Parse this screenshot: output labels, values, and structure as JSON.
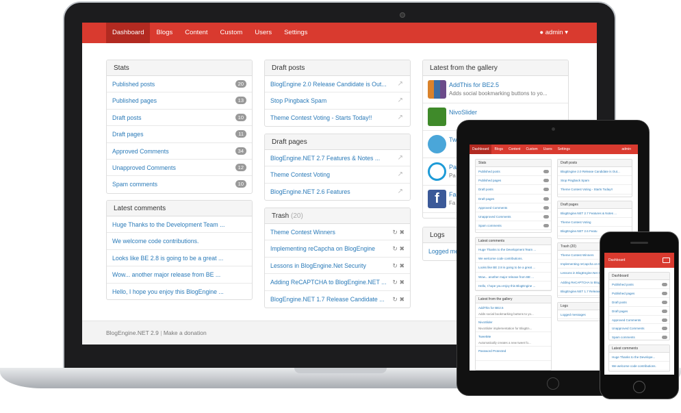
{
  "nav": {
    "items": [
      "Dashboard",
      "Blogs",
      "Content",
      "Custom",
      "Users",
      "Settings"
    ],
    "user": "admin"
  },
  "stats": {
    "title": "Stats",
    "rows": [
      {
        "label": "Published posts",
        "count": "20"
      },
      {
        "label": "Published pages",
        "count": "13"
      },
      {
        "label": "Draft posts",
        "count": "10"
      },
      {
        "label": "Draft pages",
        "count": "11"
      },
      {
        "label": "Approved Comments",
        "count": "34"
      },
      {
        "label": "Unapproved Comments",
        "count": "12"
      },
      {
        "label": "Spam comments",
        "count": "10"
      }
    ]
  },
  "latest_comments": {
    "title": "Latest comments",
    "rows": [
      "Huge Thanks to the Development Team ...",
      "We welcome code contributions.",
      "Looks like BE 2.8 is going to be a great ...",
      "Wow... another major release from BE ...",
      "Hello, I hope you enjoy this BlogEngine ..."
    ]
  },
  "draft_posts": {
    "title": "Draft posts",
    "rows": [
      "BlogEngine 2.0 Release Candidate is Out...",
      "Stop Pingback Spam",
      "Theme Contest Voting - Starts Today!!"
    ]
  },
  "draft_pages": {
    "title": "Draft pages",
    "rows": [
      "BlogEngine.NET 2.7 Features & Notes ...",
      "Theme Contest Voting",
      "BlogEngine.NET 2.6 Features"
    ]
  },
  "trash": {
    "title": "Trash",
    "count": "(20)",
    "rows": [
      "Theme Contest Winners",
      "Implementing reCapcha on BlogEngine",
      "Lessons in BlogEngine.Net Security",
      "Adding ReCAPTCHA to BlogEngine.NET ...",
      "BlogEngine.NET 1.7 Release Candidate ..."
    ]
  },
  "gallery": {
    "title": "Latest from the gallery",
    "items": [
      {
        "name": "AddThis for BE2.5",
        "desc": "Adds social bookmarking buttons to yo..."
      },
      {
        "name": "NivoSlider",
        "desc": ""
      },
      {
        "name": "Tw",
        "desc": ""
      },
      {
        "name": "Pa",
        "desc": "Pa"
      },
      {
        "name": "Fa",
        "desc": "Fa"
      }
    ]
  },
  "logs": {
    "title": "Logs",
    "row": "Logged me"
  },
  "footer": {
    "version": "BlogEngine.NET 2.9",
    "separator": "|",
    "donate": "Make a donation"
  },
  "tablet": {
    "nav": [
      "Dashboard",
      "Blogs",
      "Content",
      "Custom",
      "Users",
      "Settings"
    ],
    "user": "admin",
    "stats_rows": [
      "Published posts",
      "Published pages",
      "Draft posts",
      "Draft pages",
      "Approved Comments",
      "Unapproved Comments",
      "Spam comments"
    ],
    "comment_rows": [
      "Huge Thanks to the Development Team ...",
      "We welcome code contributions.",
      "Looks like BE 2.8 is going to be a great ...",
      "Wow... another major release from BE ...",
      "Hello, I hope you enjoy this BlogEngine ..."
    ],
    "gallery_rows": [
      {
        "name": "AddThis for BE2.5",
        "desc": "Adds social bookmarking buttons to yo..."
      },
      {
        "name": "NivoSlider",
        "desc": "NivoSlider implementation for BlogEn..."
      },
      {
        "name": "TweetMe",
        "desc": "Automatically creates a new tweet fo..."
      },
      {
        "name": "Password Protected",
        "desc": ""
      }
    ],
    "draft_posts_rows": [
      "BlogEngine 2.0 Release Candidate is Out...",
      "Stop Pingback Spam",
      "Theme Contest Voting - Starts Today!!"
    ],
    "draft_pages_rows": [
      "BlogEngine.NET 2.7 Features & Notes ...",
      "Theme Contest Voting",
      "BlogEngine.NET 2.6 Featu"
    ],
    "trash_title": "Trash (20)",
    "trash_rows": [
      "Theme Contest Winners",
      "Implementing reCapcha on BlogEngine",
      "Lessons in BlogEngine.Net Security",
      "Adding ReCAPTCHA to BlogEngi",
      "BlogEngine.NET 1.7 Release"
    ],
    "logs_title": "Logs",
    "logs_row": "Logged messages"
  },
  "phone": {
    "nav": "Dashboard",
    "stats_title": "Dashboard",
    "stats_rows": [
      "Published posts",
      "Published pages",
      "Draft posts",
      "Draft pages",
      "Approved Comments",
      "Unapproved Comments",
      "Spam comments"
    ],
    "comments_title": "Latest comments",
    "comment_rows": [
      "Huge Thanks to the Develope...",
      "We welcome code contributions."
    ]
  }
}
